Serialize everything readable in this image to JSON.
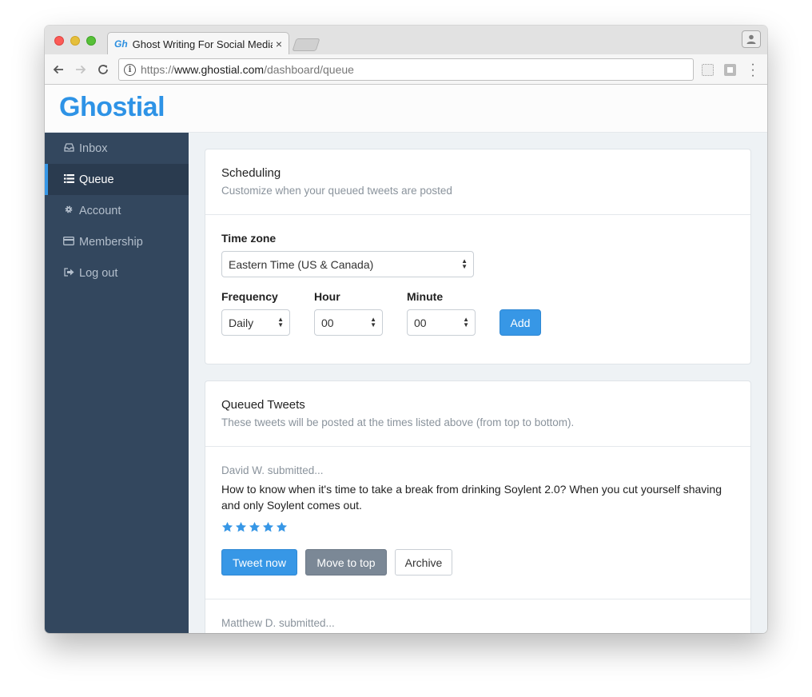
{
  "browser": {
    "tab_favicon": "Gh",
    "tab_title": "Ghost Writing For Social Media",
    "tab_close": "×",
    "url_scheme": "https://",
    "url_host": "www.ghostial.com",
    "url_path": "/dashboard/queue",
    "info_glyph": "i"
  },
  "app": {
    "logo": "Ghostial",
    "brand_color": "#2e93e6"
  },
  "sidebar": {
    "items": [
      {
        "label": "Inbox",
        "icon": "inbox-icon",
        "active": false
      },
      {
        "label": "Queue",
        "icon": "list-icon",
        "active": true
      },
      {
        "label": "Account",
        "icon": "gear-icon",
        "active": false
      },
      {
        "label": "Membership",
        "icon": "credit-card-icon",
        "active": false
      },
      {
        "label": "Log out",
        "icon": "logout-icon",
        "active": false
      }
    ]
  },
  "scheduling": {
    "title": "Scheduling",
    "subtitle": "Customize when your queued tweets are posted",
    "timezone_label": "Time zone",
    "timezone_value": "Eastern Time (US & Canada)",
    "frequency_label": "Frequency",
    "frequency_value": "Daily",
    "hour_label": "Hour",
    "hour_value": "00",
    "minute_label": "Minute",
    "minute_value": "00",
    "add_label": "Add"
  },
  "queue": {
    "title": "Queued Tweets",
    "subtitle": "These tweets will be posted at the times listed above (from top to bottom).",
    "tweets": [
      {
        "author": "David W. submitted...",
        "text": "How to know when it's time to take a break from drinking Soylent 2.0? When you cut yourself shaving and only Soylent comes out.",
        "rating": 5,
        "rating_max": 5
      },
      {
        "author": "Matthew D. submitted..."
      }
    ],
    "tweet_now_label": "Tweet now",
    "move_to_top_label": "Move to top",
    "archive_label": "Archive"
  },
  "help": {
    "glyph": "?"
  },
  "colors": {
    "accent": "#3797e6",
    "sidebar_bg": "#33475e",
    "sidebar_active_bg": "#2a3b4f",
    "secondary_button": "#7b8896"
  }
}
